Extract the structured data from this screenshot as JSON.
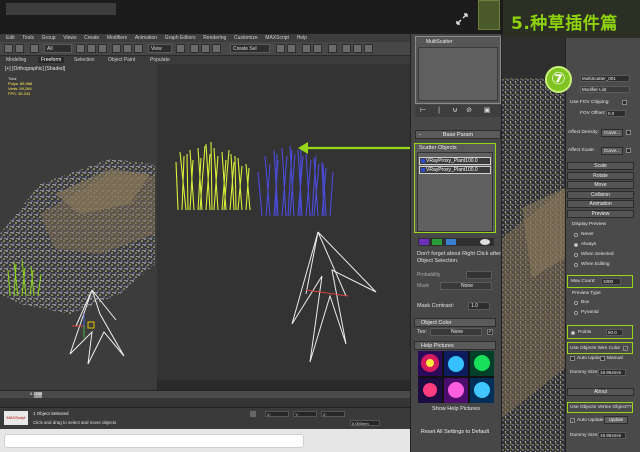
{
  "banner": {
    "title": "5.种草插件篇",
    "step_number": "⑦"
  },
  "main": {
    "menu": [
      "Edit",
      "Tools",
      "Group",
      "Views",
      "Create",
      "Modifiers",
      "Animation",
      "Graph Editors",
      "Rendering",
      "Customize",
      "MAXScript",
      "Help"
    ],
    "ribbon_tabs": [
      "Modeling",
      "Freeform",
      "Selection",
      "Object Paint",
      "Populate"
    ],
    "viewport_label": "[+] [Orthographic] [Shaded]",
    "stats": {
      "total_label": "Total",
      "polys_label": "Polys:",
      "polys": "88,986",
      "verts_label": "Verts:",
      "verts": "59,269",
      "fps_label": "FPS:",
      "fps": "36.243"
    },
    "timeline_label": "0 / 100",
    "status": {
      "maxscript": "MAXScript Mi",
      "selection": "1 Object Selected",
      "hint": "Click and drag to select and move objects",
      "scale": "0.000mm",
      "x": "X:",
      "y": "Y:",
      "z": "Z:"
    }
  },
  "panel": {
    "name": "MultiScatter",
    "base_param": "Base Param",
    "scatter_objects_label": "Scatter Objects",
    "scatter_items": [
      "VRayProxy_Plant100.0",
      "VRayProxy_Plant100.0"
    ],
    "hint": "Don't forget about Right Click after Object Selection.",
    "probability_label": "Probability",
    "mask_label": "Mask",
    "mask_value": "None",
    "mask_contrast_label": "Mask Contrast:",
    "mask_contrast_value": "1.0",
    "object_color_label": "Object Color",
    "tex_label": "Tex:",
    "tex_value": "None",
    "help_pictures_label": "Help Pictures",
    "show_help_label": "Show Help Pictures",
    "reset_label": "Reset All Settings to Default"
  },
  "right": {
    "object_name": "MultiScatter_001",
    "modifier_list": "Modifier List",
    "use_fov_label": "Use FOV Clipping:",
    "fov_offset_label": "FOV Offset:",
    "fov_offset_value": "0.0",
    "affect_density_label": "Affect Density:",
    "affect_density_btn": "Curve...",
    "affect_scale_label": "Affect Scale:",
    "affect_scale_btn": "Curve...",
    "sections": [
      "Scale",
      "Rotate",
      "Move",
      "Collision",
      "Animation",
      "Preview"
    ],
    "display_preview_label": "Display Preview",
    "never_label": "Never",
    "always_label": "Always",
    "when_selected_label": "When Selected",
    "when_editing_label": "When Editing",
    "max_count_label": "Max Count:",
    "max_count_value": "1000",
    "preview_type_label": "Preview Type",
    "box_label": "Box",
    "pyramid_label": "Pyramid",
    "points_label": "Points",
    "points_value": "50.0",
    "use_wire_color_label": "Use Objects Wire Color",
    "auto_update_label": "Auto Update",
    "manual_label": "Manual",
    "dummy_size_label": "Dummy Size:",
    "dummy_size_value": "19.954mm",
    "about_label": "About",
    "use_objects_vertex_label": "Use Objects Vertex Object??",
    "auto_update2_label": "Auto Update",
    "update_label": "Update",
    "dummy_size2_label": "Dummy Size:",
    "dummy_size2_value": "19.954mm"
  },
  "colors": {
    "accent": "#98d61a",
    "grass_yellow": "#d8ef3a",
    "grass_blue": "#4b4cdc"
  }
}
